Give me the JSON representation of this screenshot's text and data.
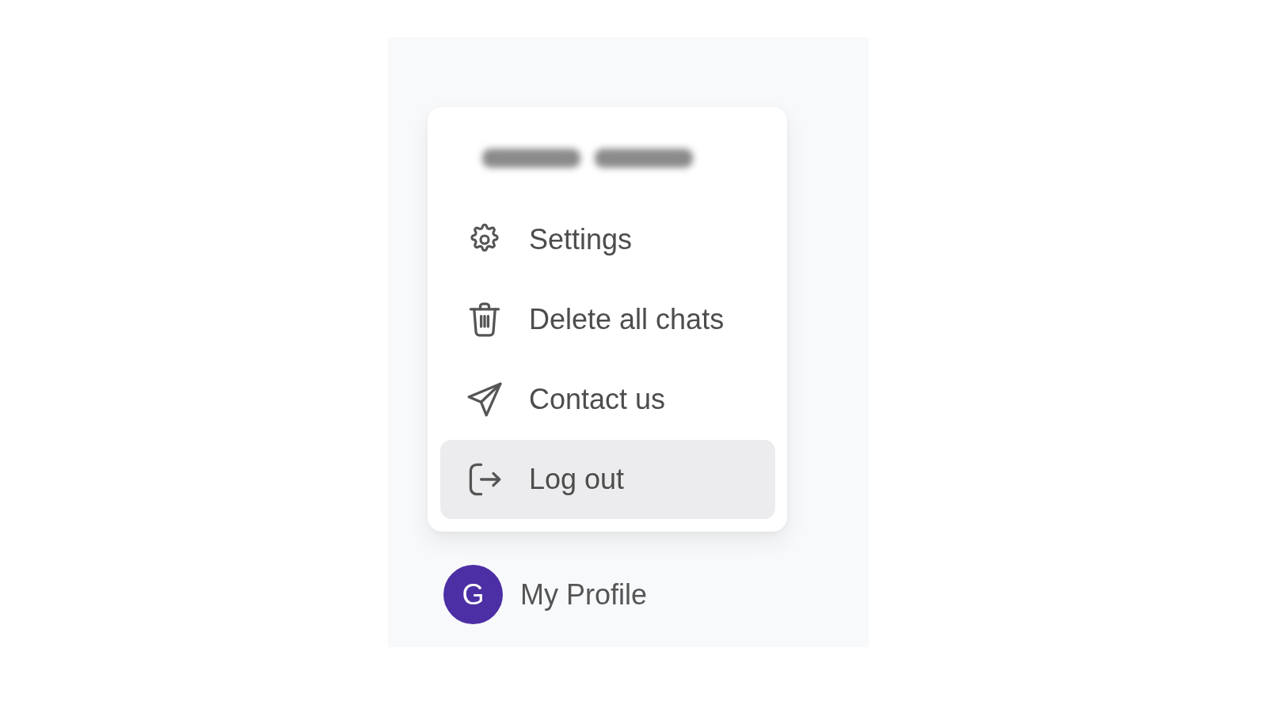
{
  "menu": {
    "user_name_blurred": true,
    "items": [
      {
        "kind": "settings",
        "label": "Settings",
        "selected": false
      },
      {
        "kind": "delete",
        "label": "Delete all chats",
        "selected": false
      },
      {
        "kind": "contact",
        "label": "Contact us",
        "selected": false
      },
      {
        "kind": "logout",
        "label": "Log out",
        "selected": true
      }
    ]
  },
  "profile": {
    "avatar_initial": "G",
    "label": "My Profile"
  }
}
